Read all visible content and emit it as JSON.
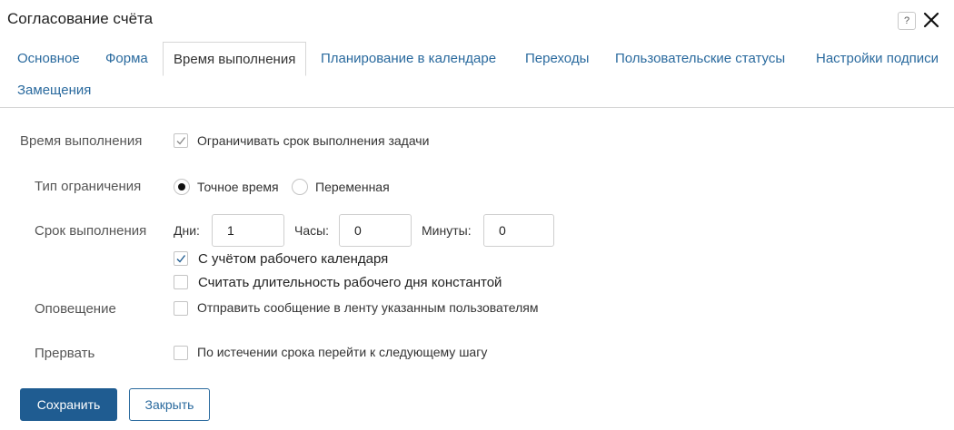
{
  "dialog": {
    "title": "Согласование счёта",
    "help_label": "?"
  },
  "tabs": [
    {
      "label": "Основное"
    },
    {
      "label": "Форма"
    },
    {
      "label": "Время выполнения",
      "active": true
    },
    {
      "label": "Планирование в календаре"
    },
    {
      "label": "Переходы"
    },
    {
      "label": "Пользовательские статусы"
    },
    {
      "label": "Настройки подписи"
    },
    {
      "label": "Замещения"
    }
  ],
  "execution_time": {
    "label": "Время выполнения",
    "limit_checkbox": {
      "label": "Ограничивать срок выполнения задачи",
      "checked": true
    }
  },
  "limit_type": {
    "label": "Тип ограничения",
    "options": [
      {
        "label": "Точное время",
        "selected": true
      },
      {
        "label": "Переменная",
        "selected": false
      }
    ]
  },
  "deadline": {
    "label": "Срок выполнения",
    "days_label": "Дни:",
    "days_value": "1",
    "hours_label": "Часы:",
    "hours_value": "0",
    "minutes_label": "Минуты:",
    "minutes_value": "0",
    "work_calendar": {
      "label": "С учётом рабочего календаря",
      "checked": true
    },
    "constant_day": {
      "label": "Считать длительность рабочего дня константой",
      "checked": false
    }
  },
  "notification": {
    "label": "Оповещение",
    "checkbox": {
      "label": "Отправить сообщение в ленту указанным пользователям",
      "checked": false
    }
  },
  "interrupt": {
    "label": "Прервать",
    "checkbox": {
      "label": "По истечении срока перейти к следующему шагу",
      "checked": false
    }
  },
  "buttons": {
    "save": "Сохранить",
    "close": "Закрыть"
  }
}
